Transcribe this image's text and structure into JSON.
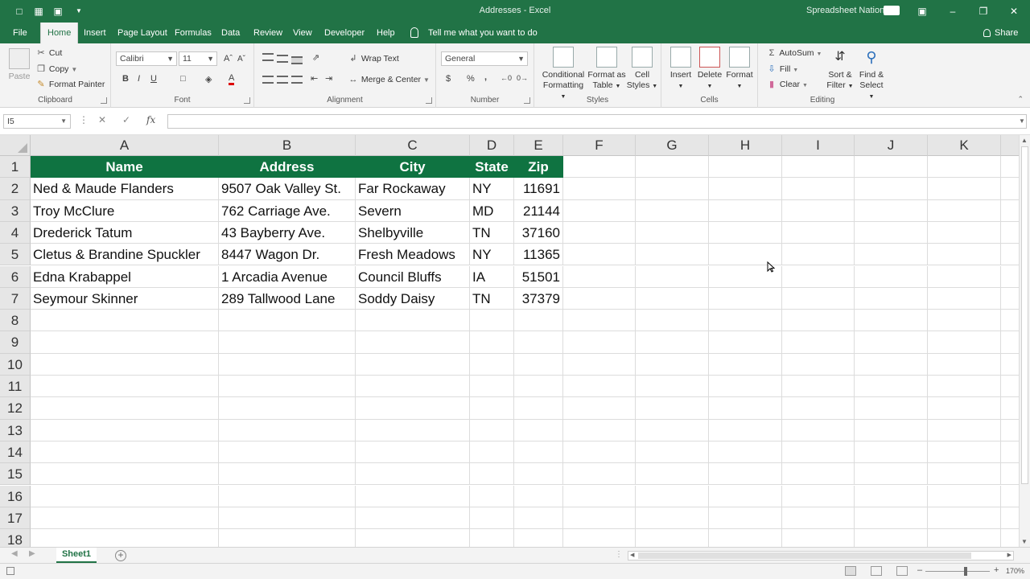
{
  "app": {
    "window_title": "Addresses  -  Excel",
    "user_name": "Spreadsheet Nation",
    "accent_color": "#217346",
    "header_fill": "#0f7341"
  },
  "ribbon_tabs": [
    "File",
    "Home",
    "Insert",
    "Page Layout",
    "Formulas",
    "Data",
    "Review",
    "View",
    "Developer",
    "Help"
  ],
  "active_tab": "Home",
  "tell_me": "Tell me what you want to do",
  "share_label": "Share",
  "ribbon": {
    "clipboard": {
      "label": "Clipboard",
      "paste": "Paste",
      "cut": "Cut",
      "copy": "Copy",
      "format_painter": "Format Painter"
    },
    "font": {
      "label": "Font",
      "name": "Calibri",
      "size": "11",
      "bold": "B",
      "italic": "I",
      "underline": "U"
    },
    "alignment": {
      "label": "Alignment",
      "wrap_text": "Wrap Text",
      "merge_center": "Merge & Center"
    },
    "number": {
      "label": "Number",
      "format": "General",
      "currency": "$",
      "percent": "%",
      "comma": ","
    },
    "styles": {
      "label": "Styles",
      "conditional": "Conditional",
      "formatting": "Formatting",
      "format_as": "Format as",
      "table": "Table",
      "cell": "Cell",
      "styles_btn": "Styles"
    },
    "cells": {
      "label": "Cells",
      "insert": "Insert",
      "delete": "Delete",
      "format": "Format"
    },
    "editing": {
      "label": "Editing",
      "autosum": "AutoSum",
      "fill": "Fill",
      "clear": "Clear",
      "sort": "Sort &",
      "filter": "Filter",
      "find": "Find &",
      "select": "Select"
    }
  },
  "formula_bar": {
    "name_box": "I5",
    "fx": "fx",
    "formula": ""
  },
  "columns": [
    "A",
    "B",
    "C",
    "D",
    "E",
    "F",
    "G",
    "H",
    "I",
    "J",
    "K"
  ],
  "row_numbers": [
    "1",
    "2",
    "3",
    "4",
    "5",
    "6",
    "7",
    "8",
    "9",
    "10",
    "11",
    "12",
    "13",
    "14",
    "15",
    "16",
    "17",
    "18"
  ],
  "table": {
    "headers": [
      "Name",
      "Address",
      "City",
      "State",
      "Zip"
    ],
    "rows": [
      [
        "Ned & Maude Flanders",
        "9507 Oak Valley St.",
        "Far Rockaway",
        "NY",
        "11691"
      ],
      [
        "Troy McClure",
        "762 Carriage Ave.",
        "Severn",
        "MD",
        "21144"
      ],
      [
        "Drederick Tatum",
        "43 Bayberry Ave.",
        "Shelbyville",
        "TN",
        "37160"
      ],
      [
        "Cletus & Brandine Spuckler",
        "8447 Wagon Dr.",
        "Fresh Meadows",
        "NY",
        "11365"
      ],
      [
        "Edna Krabappel",
        "1 Arcadia Avenue",
        "Council Bluffs",
        "IA",
        "51501"
      ],
      [
        "Seymour Skinner",
        "289 Tallwood Lane",
        "Soddy Daisy",
        "TN",
        "37379"
      ]
    ]
  },
  "sheets": [
    "Sheet1"
  ],
  "status": {
    "zoom": "170%"
  }
}
